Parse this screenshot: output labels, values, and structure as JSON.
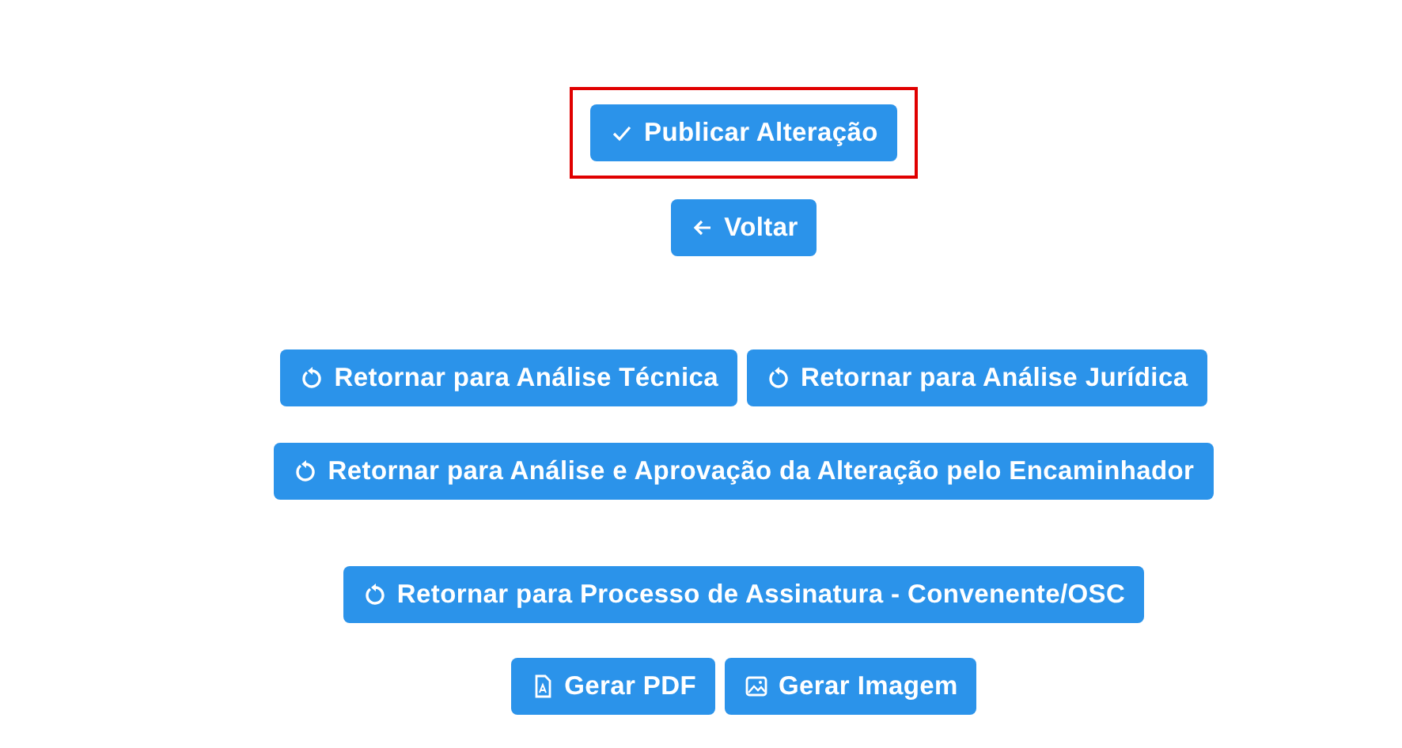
{
  "button_rows": [
    {
      "buttons": [
        {
          "label": "Publicar Alteração",
          "kind": "check",
          "highlighted": true
        }
      ]
    },
    {
      "buttons": [
        {
          "label": "Voltar",
          "kind": "back",
          "highlighted": false
        }
      ]
    },
    {
      "buttons": [
        {
          "label": "Retornar para Análise Técnica",
          "kind": "return",
          "highlighted": false
        },
        {
          "label": "Retornar para Análise Jurídica",
          "kind": "return",
          "highlighted": false
        }
      ]
    },
    {
      "buttons": [
        {
          "label": "Retornar para Análise e Aprovação da Alteração pelo Encaminhador",
          "kind": "return",
          "highlighted": false
        }
      ]
    },
    {
      "buttons": [
        {
          "label": "Retornar para Processo de Assinatura - Convenente/OSC",
          "kind": "return",
          "highlighted": false
        }
      ]
    },
    {
      "buttons": [
        {
          "label": "Gerar PDF",
          "kind": "pdf",
          "highlighted": false
        },
        {
          "label": "Gerar Imagem",
          "kind": "image",
          "highlighted": false
        }
      ]
    }
  ]
}
